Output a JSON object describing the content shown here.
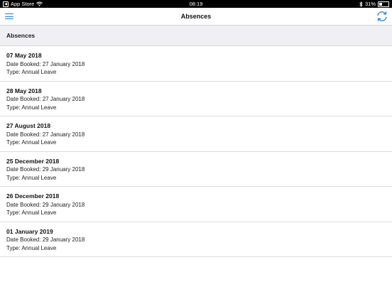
{
  "status_bar": {
    "back_app": "App Store",
    "time": "08:19",
    "battery": "31%",
    "battery_level": 0.31
  },
  "navbar": {
    "title": "Absences",
    "menu_icon": "hamburger-menu-icon",
    "refresh_icon": "refresh-icon",
    "accent_color": "#1e7fd8"
  },
  "section": {
    "title": "Absences"
  },
  "absences": [
    {
      "date": "07 May 2018",
      "booked": "Date Booked: 27 January 2018",
      "type": "Type: Annual Leave"
    },
    {
      "date": "28 May 2018",
      "booked": "Date Booked: 27 January 2018",
      "type": "Type: Annual Leave"
    },
    {
      "date": "27 August 2018",
      "booked": "Date Booked: 27 January 2018",
      "type": "Type: Annual Leave"
    },
    {
      "date": "25 December 2018",
      "booked": "Date Booked: 29 January 2018",
      "type": "Type: Annual Leave"
    },
    {
      "date": "26 December 2018",
      "booked": "Date Booked: 29 January 2018",
      "type": "Type: Annual Leave"
    },
    {
      "date": "01 January 2019",
      "booked": "Date Booked: 29 January 2018",
      "type": "Type: Annual Leave"
    }
  ]
}
